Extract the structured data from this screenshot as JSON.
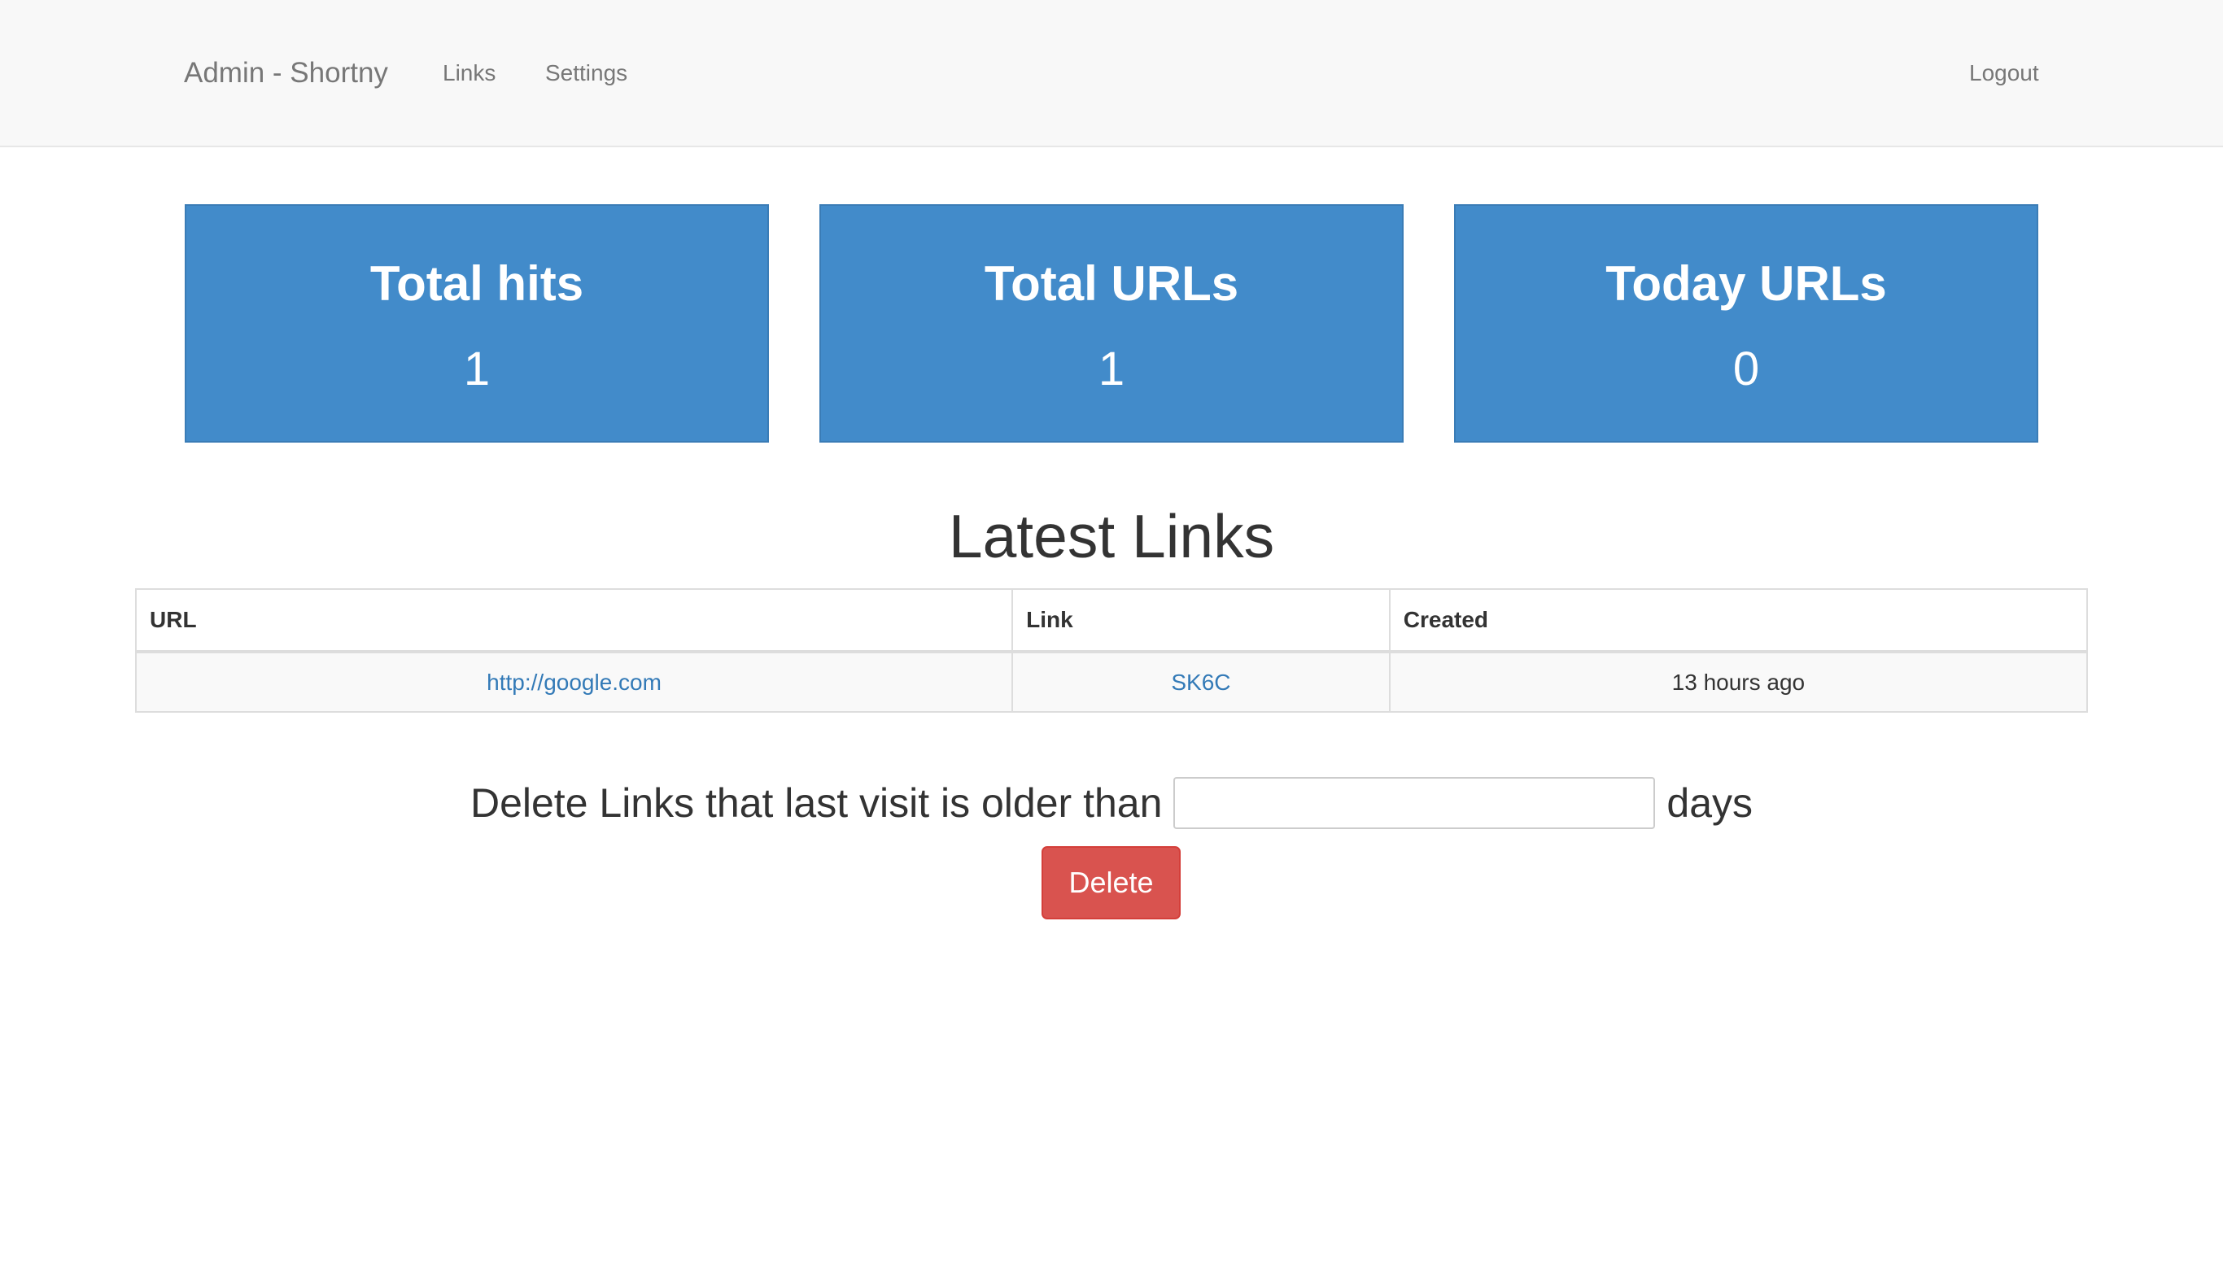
{
  "navbar": {
    "brand": "Admin - Shortny",
    "links_label": "Links",
    "settings_label": "Settings",
    "logout_label": "Logout",
    "background": "#f8f8f8"
  },
  "stats": [
    {
      "label": "Total hits",
      "value": "1"
    },
    {
      "label": "Total URLs",
      "value": "1"
    },
    {
      "label": "Today URLs",
      "value": "0"
    }
  ],
  "stat_card_color": "#428bca",
  "latest_links": {
    "title": "Latest Links",
    "columns": [
      "URL",
      "Link",
      "Created"
    ],
    "rows": [
      {
        "url": "http://google.com",
        "link": "SK6C",
        "created": "13 hours ago"
      }
    ],
    "link_color": "#337ab7"
  },
  "delete_form": {
    "prefix": "Delete Links that last visit is older than",
    "input_value": "",
    "suffix": "days",
    "button_label": "Delete",
    "button_color": "#d9534f"
  }
}
